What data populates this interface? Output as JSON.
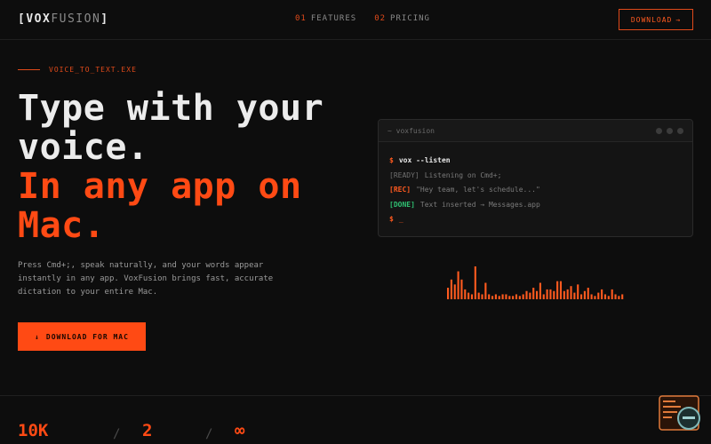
{
  "header": {
    "logo_open": "[",
    "logo_main": "VOX",
    "logo_accent": "FUSION",
    "logo_close": "]",
    "nav": [
      {
        "num": "01",
        "label": "FEATURES"
      },
      {
        "num": "02",
        "label": "PRICING"
      }
    ],
    "download_label": "DOWNLOAD",
    "download_arrow": "→"
  },
  "hero": {
    "tag": "VOICE_TO_TEXT.EXE",
    "title_line1": "Type with your",
    "title_line2": "voice.",
    "title_line3": "In any app on",
    "title_line4": "Mac.",
    "description": "Press Cmd+;, speak naturally, and your words appear instantly in any app. VoxFusion brings fast, accurate dictation to your entire Mac.",
    "cta_icon": "↓",
    "cta_label": "DOWNLOAD FOR MAC"
  },
  "terminal": {
    "title": "~ voxfusion",
    "lines": [
      {
        "prefix": "$",
        "text": "vox --listen"
      },
      {
        "prefix": "[READY]",
        "text": "Listening on Cmd+;"
      },
      {
        "prefix": "[REC]",
        "text": "\"Hey team, let's schedule...\""
      },
      {
        "prefix": "[DONE]",
        "text": "Text inserted → Messages.app"
      },
      {
        "prefix": "$",
        "text": "_"
      }
    ]
  },
  "waveform": {
    "color": "#ff5a1f",
    "levels": [
      0.35,
      0.6,
      0.45,
      0.85,
      0.6,
      0.3,
      0.2,
      0.15,
      1.0,
      0.2,
      0.15,
      0.5,
      0.15,
      0.1,
      0.15,
      0.1,
      0.15,
      0.15,
      0.1,
      0.1,
      0.15,
      0.1,
      0.15,
      0.25,
      0.2,
      0.35,
      0.25,
      0.5,
      0.15,
      0.3,
      0.3,
      0.25,
      0.55,
      0.55,
      0.25,
      0.3,
      0.4,
      0.2,
      0.45,
      0.15,
      0.25,
      0.35,
      0.15,
      0.1,
      0.2,
      0.3,
      0.15,
      0.1,
      0.3,
      0.15,
      0.1,
      0.15
    ]
  },
  "stats": [
    {
      "value": "10K"
    },
    {
      "value": "2"
    },
    {
      "value": "∞"
    }
  ],
  "stat_separator": "/",
  "colors": {
    "accent": "#ff4a14",
    "background": "#0d0d0d",
    "success": "#2fbf71"
  }
}
